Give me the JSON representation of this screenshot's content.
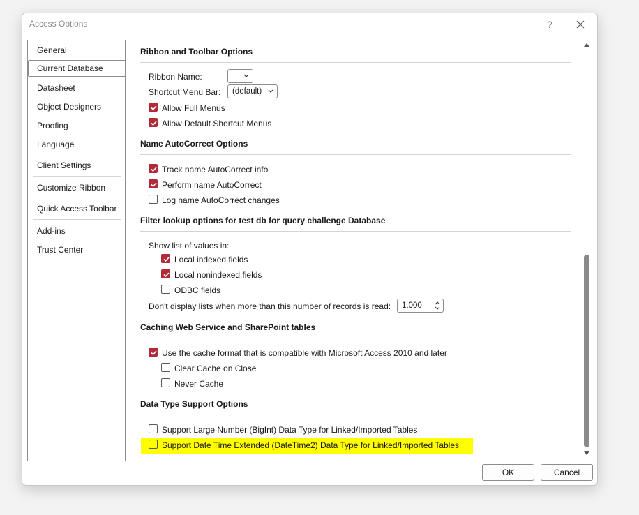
{
  "window": {
    "title": "Access Options",
    "help_label": "?"
  },
  "sidebar": {
    "items": [
      {
        "label": "General"
      },
      {
        "label": "Current Database"
      },
      {
        "label": "Datasheet"
      },
      {
        "label": "Object Designers"
      },
      {
        "label": "Proofing"
      },
      {
        "label": "Language"
      },
      {
        "label": "Client Settings"
      },
      {
        "label": "Customize Ribbon"
      },
      {
        "label": "Quick Access Toolbar"
      },
      {
        "label": "Add-ins"
      },
      {
        "label": "Trust Center"
      }
    ],
    "selected": "Current Database"
  },
  "ribbon": {
    "title": "Ribbon and Toolbar Options",
    "ribbon_name_label": "Ribbon Name:",
    "ribbon_name_value": "",
    "shortcut_label": "Shortcut Menu Bar:",
    "shortcut_value": "(default)",
    "allow_full_menus": "Allow Full Menus",
    "allow_default_shortcut": "Allow Default Shortcut Menus"
  },
  "autocorrect": {
    "title": "Name AutoCorrect Options",
    "track": "Track name AutoCorrect info",
    "perform": "Perform name AutoCorrect",
    "log": "Log name AutoCorrect changes"
  },
  "filter": {
    "title": "Filter lookup options for test db for query challenge Database",
    "show_list": "Show list of values in:",
    "local_indexed": "Local indexed fields",
    "local_nonindexed": "Local nonindexed fields",
    "odbc": "ODBC fields",
    "records_label": "Don't display lists when more than this number of records is read:",
    "records_value": "1,000"
  },
  "caching": {
    "title": "Caching Web Service and SharePoint tables",
    "use_cache": "Use the cache format that is compatible with Microsoft Access 2010 and later",
    "clear_cache": "Clear Cache on Close",
    "never_cache": "Never Cache"
  },
  "datatype": {
    "title": "Data Type Support Options",
    "bigint": "Support Large Number (BigInt) Data Type for Linked/Imported Tables",
    "datetime2": "Support Date Time Extended (DateTime2) Data Type for Linked/Imported Tables"
  },
  "buttons": {
    "ok": "OK",
    "cancel": "Cancel"
  },
  "colors": {
    "checkbox_accent": "#b02a37",
    "highlight": "#ffff00"
  }
}
